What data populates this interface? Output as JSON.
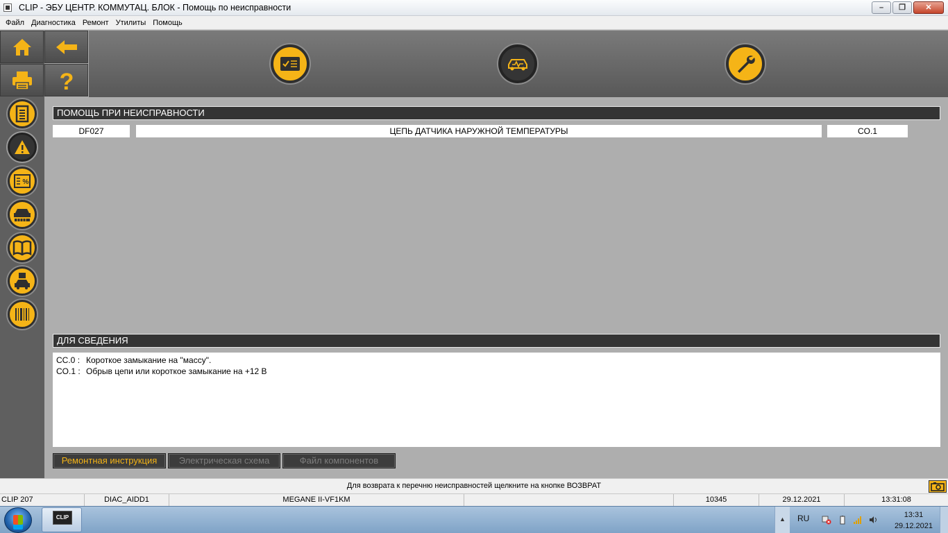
{
  "window": {
    "title": "CLIP - ЭБУ ЦЕНТР. КОММУТАЦ. БЛОК - Помощь по неисправности"
  },
  "menu": [
    "Файл",
    "Диагностика",
    "Ремонт",
    "Утилиты",
    "Помощь"
  ],
  "toolbar": {
    "left_top": [
      "home-icon",
      "back-arrow-icon",
      "printer-icon",
      "help-icon"
    ],
    "left_side": [
      "document-list-icon",
      "warning-icon",
      "parameters-percent-icon",
      "vehicle-status-icon",
      "book-icon",
      "vehicle-save-icon",
      "barcode-icon"
    ],
    "top": [
      "checklist-icon",
      "vehicle-diagnostic-icon",
      "wrench-icon"
    ]
  },
  "fault_help": {
    "header": "ПОМОЩЬ ПРИ НЕИСПРАВНОСТИ",
    "code": "DF027",
    "description": "ЦЕПЬ ДАТЧИКА НАРУЖНОЙ ТЕМПЕРАТУРЫ",
    "status": "CO.1"
  },
  "info": {
    "header": "ДЛЯ СВЕДЕНИЯ",
    "lines": [
      {
        "code": "CC.0",
        "sep": ":",
        "text": "Короткое замыкание на \"массу\"."
      },
      {
        "code": "CO.1",
        "sep": ":",
        "text": "Обрыв цепи или короткое замыкание на +12 В"
      }
    ]
  },
  "tabs": [
    {
      "label": "Ремонтная инструкция",
      "state": "active"
    },
    {
      "label": "Электрическая схема",
      "state": "disabled"
    },
    {
      "label": "Файл компонентов",
      "state": "disabled"
    }
  ],
  "hint": "Для возврата к перечню неисправностей щелкните на кнопке ВОЗВРАТ",
  "status": {
    "clip": "CLIP 207",
    "diag": "DIAC_AIDD1",
    "vehicle": "MEGANE II-VF1KM",
    "blank": "",
    "code": "10345",
    "date": "29.12.2021",
    "time": "13:31:08"
  },
  "taskbar": {
    "app_label": "CLIP",
    "lang": "RU",
    "clock_time": "13:31",
    "clock_date": "29.12.2021"
  },
  "colors": {
    "accent": "#f5b417",
    "header_bg": "#343434",
    "content_bg": "#aeaeae"
  }
}
